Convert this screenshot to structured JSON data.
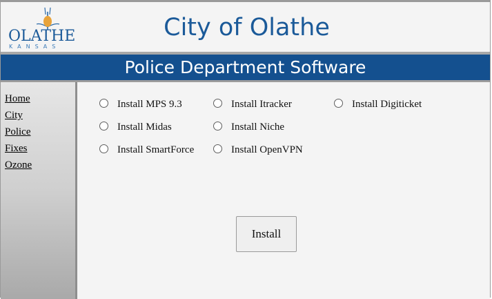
{
  "header": {
    "logo": {
      "word": "OLATHE",
      "sub": "KANSAS"
    },
    "title": "City of Olathe"
  },
  "banner": {
    "title": "Police Department Software"
  },
  "sidebar": {
    "links": [
      "Home",
      "City",
      "Police",
      "Fixes",
      "Ozone"
    ]
  },
  "options": [
    "Install MPS 9.3",
    "Install Itracker",
    "Install Digiticket",
    "Install Midas",
    "Install Niche",
    "Install SmartForce",
    "Install OpenVPN"
  ],
  "install_button": {
    "label": "Install"
  },
  "colors": {
    "brand_blue": "#14508f",
    "title_blue": "#1b5a99",
    "logo_orange": "#e8a33a"
  }
}
